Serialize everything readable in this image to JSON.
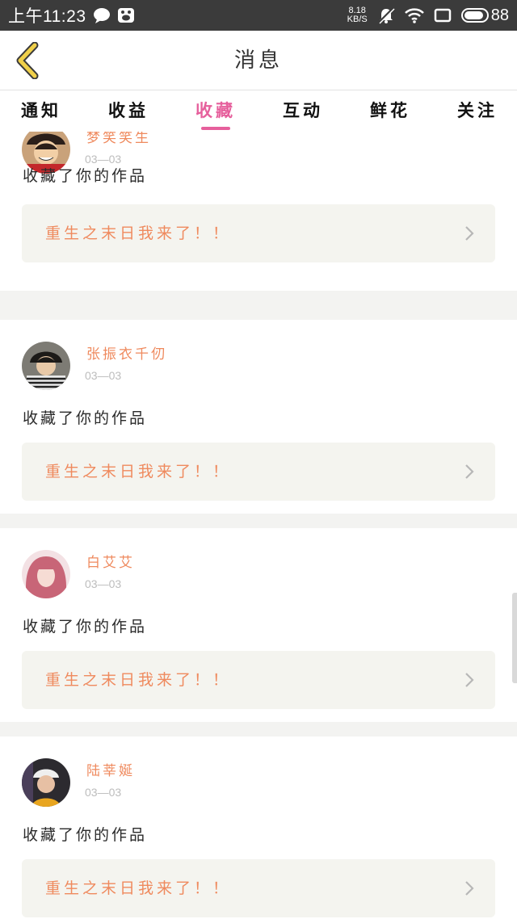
{
  "status_bar": {
    "time": "上午11:23",
    "net_speed_value": "8.18",
    "net_speed_unit": "KB/S",
    "battery": "88",
    "battery_level": 0.88,
    "icons": [
      "chat-bubble-icon",
      "paw-icon",
      "mute-bell-icon",
      "wifi-icon",
      "screen-icon",
      "battery-icon"
    ]
  },
  "navbar": {
    "title": "消息",
    "back_icon": "chevron-left-icon"
  },
  "tabs": [
    {
      "label": "通知",
      "active": false
    },
    {
      "label": "收益",
      "active": false
    },
    {
      "label": "收藏",
      "active": true
    },
    {
      "label": "互动",
      "active": false
    },
    {
      "label": "鲜花",
      "active": false
    },
    {
      "label": "关注",
      "active": false
    }
  ],
  "items": [
    {
      "name": "梦笑笑生",
      "date": "03—03",
      "action": "收藏了你的作品",
      "work_title": "重生之末日我来了！！"
    },
    {
      "name": "张振衣千仞",
      "date": "03—03",
      "action": "收藏了你的作品",
      "work_title": "重生之末日我来了！！"
    },
    {
      "name": "白艾艾",
      "date": "03—03",
      "action": "收藏了你的作品",
      "work_title": "重生之末日我来了！！"
    },
    {
      "name": "陆莘娫",
      "date": "03—03",
      "action": "收藏了你的作品",
      "work_title": "重生之末日我来了！！"
    }
  ],
  "colors": {
    "accent_pink": "#e65f9c",
    "orange_text": "#ef8a5e",
    "back_arrow": "#f0d04a",
    "status_bar_bg": "#3b3b3b",
    "work_box_bg": "#f4f4ef"
  }
}
